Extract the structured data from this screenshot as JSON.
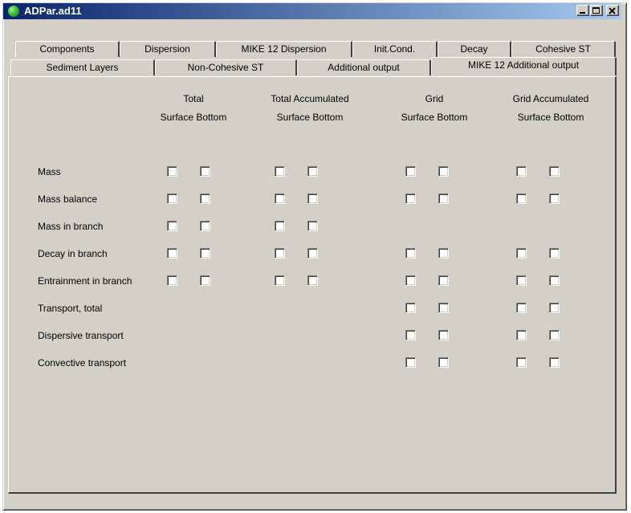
{
  "window": {
    "title": "ADPar.ad11"
  },
  "tabs": {
    "row_back": [
      "Components",
      "Dispersion",
      "MIKE 12 Dispersion",
      "Init.Cond.",
      "Decay",
      "Cohesive ST"
    ],
    "row_front": [
      "Sediment Layers",
      "Non-Cohesive ST",
      "Additional output",
      "MIKE 12 Additional output"
    ],
    "active": "MIKE 12 Additional output"
  },
  "headers": [
    {
      "line1": "Total",
      "line2": "Surface Bottom"
    },
    {
      "line1": "Total Accumulated",
      "line2": "Surface Bottom"
    },
    {
      "line1": "Grid",
      "line2": "Surface Bottom"
    },
    {
      "line1": "Grid Accumulated",
      "line2": "Surface Bottom"
    }
  ],
  "rows": [
    {
      "label": "Mass",
      "groups": [
        true,
        true,
        true,
        true
      ]
    },
    {
      "label": "Mass balance",
      "groups": [
        true,
        true,
        true,
        true
      ]
    },
    {
      "label": "Mass in branch",
      "groups": [
        true,
        true,
        false,
        false
      ]
    },
    {
      "label": "Decay in branch",
      "groups": [
        true,
        true,
        true,
        true
      ]
    },
    {
      "label": "Entrainment in branch",
      "groups": [
        true,
        true,
        true,
        true
      ]
    },
    {
      "label": "Transport, total",
      "groups": [
        false,
        false,
        true,
        true
      ]
    },
    {
      "label": "Dispersive transport",
      "groups": [
        false,
        false,
        true,
        true
      ]
    },
    {
      "label": "Convective transport",
      "groups": [
        false,
        false,
        true,
        true
      ]
    }
  ]
}
